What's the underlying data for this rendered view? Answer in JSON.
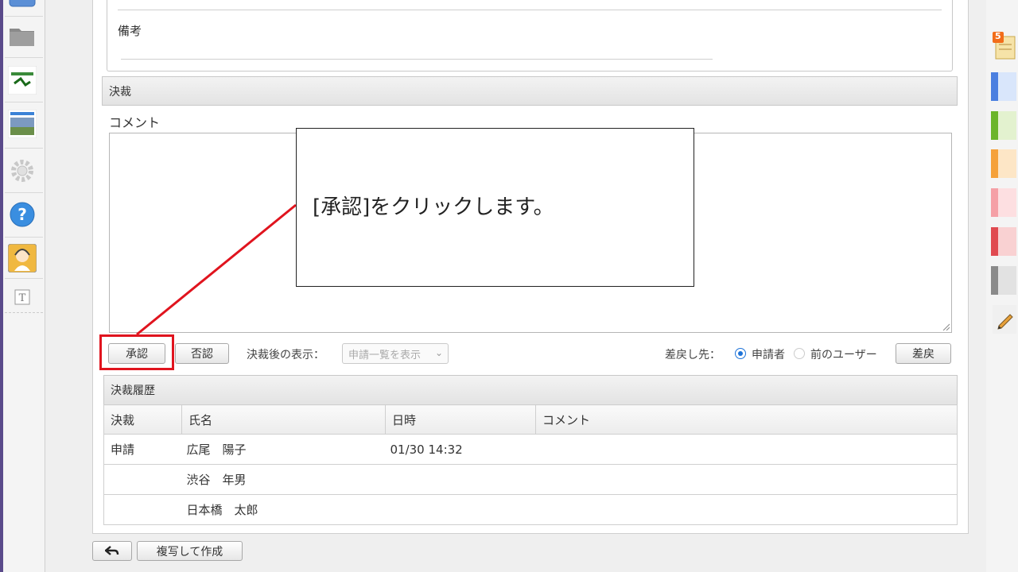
{
  "form": {
    "notes_label": "備考"
  },
  "approval": {
    "section_title": "決裁",
    "comment_label": "コメント",
    "approve_label": "承認",
    "reject_label": "否認",
    "after_display_label": "決裁後の表示：",
    "after_display_value": "申請一覧を表示",
    "return_to_label": "差戻し先：",
    "return_options": [
      "申請者",
      "前のユーザー"
    ],
    "return_selected": "申請者",
    "return_button_label": "差戻"
  },
  "history": {
    "section_title": "決裁履歴",
    "columns": [
      "決裁",
      "氏名",
      "日時",
      "コメント"
    ],
    "rows": [
      {
        "action": "申請",
        "name": "広尾　陽子",
        "datetime": "01/30 14:32",
        "comment": ""
      },
      {
        "action": "",
        "name": "渋谷　年男",
        "datetime": "",
        "comment": ""
      },
      {
        "action": "",
        "name": "日本橋　太郎",
        "datetime": "",
        "comment": ""
      }
    ]
  },
  "footer": {
    "copy_create_label": "複写して作成"
  },
  "callout": {
    "text": "[承認]をクリックします。"
  },
  "sidebar_icons": {
    "memo_badge": "5"
  },
  "colors": {
    "highlight": "#e0141e",
    "radio_accent": "#1e73d8",
    "tab_colors": [
      "#4a7fe0",
      "#6bb52a",
      "#f5a13a",
      "#f5a0a6",
      "#e04a50",
      "#8a8a8a"
    ]
  }
}
